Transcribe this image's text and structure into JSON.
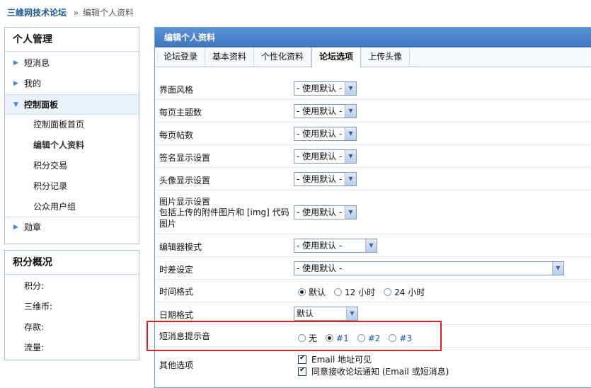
{
  "breadcrumb": {
    "site": "三維网技术论坛",
    "separator": "»",
    "current": "编辑个人资料"
  },
  "sidebar": {
    "title": "个人管理",
    "items": [
      {
        "label": "短消息"
      },
      {
        "label": "我的"
      },
      {
        "label": "控制面板"
      },
      {
        "label": "勋章"
      }
    ],
    "sub_items": [
      "控制面板首页",
      "编辑个人资料",
      "积分交易",
      "积分记录",
      "公众用户组"
    ]
  },
  "credits": {
    "title": "积分概况",
    "items": [
      "积分:",
      "三维币:",
      "存款:",
      "流量:"
    ]
  },
  "main": {
    "header": "编辑个人资料",
    "tabs": [
      "论坛登录",
      "基本资料",
      "个性化资料",
      "论坛选项",
      "上传头像"
    ],
    "active_tab": "论坛选项",
    "rows": {
      "style_label": "界面风格",
      "threads_label": "每页主题数",
      "posts_label": "每页帖数",
      "signature_label": "签名显示设置",
      "avatar_label": "头像显示设置",
      "image_label_1": "图片显示设置",
      "image_label_2": "包括上传的附件图片和 [img] 代码图片",
      "editor_label": "编辑器模式",
      "timezone_label": "时差设定",
      "timeformat_label": "时间格式",
      "dateformat_label": "日期格式",
      "sound_label": "短消息提示音",
      "other_label": "其他选项"
    },
    "default_option": "- 使用默认 -",
    "date_format_value": "默认",
    "time_format_options": [
      "默认",
      "12 小时",
      "24 小时"
    ],
    "time_format_selected": "默认",
    "sound_options": [
      "无",
      "#1",
      "#2",
      "#3"
    ],
    "sound_selected": "#1",
    "other_options": [
      "Email 地址可见",
      "同意接收论坛通知 (Email 或短消息)"
    ]
  }
}
